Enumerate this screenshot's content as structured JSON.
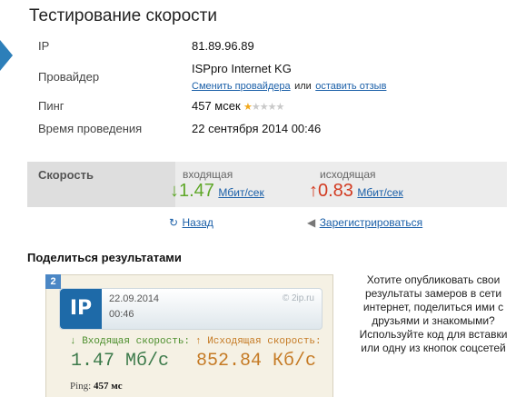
{
  "page": {
    "title": "Тестирование скорости"
  },
  "info": {
    "ip": {
      "label": "IP",
      "value": "81.89.96.89"
    },
    "provider": {
      "label": "Провайдер",
      "value": "ISPpro Internet KG",
      "change_link": "Сменить провайдера",
      "or": "или",
      "review_link": "оставить отзыв"
    },
    "ping": {
      "label": "Пинг",
      "value": "457 мсек",
      "rating": 1,
      "rating_max": 5
    },
    "time": {
      "label": "Время проведения",
      "value": "22 сентября 2014 00:46"
    }
  },
  "speed": {
    "header": "Скорость",
    "incoming": {
      "label": "входящая",
      "arrow": "↓",
      "value": "1.47",
      "unit": "Мбит/сек",
      "color": "#5ea728"
    },
    "outgoing": {
      "label": "исходящая",
      "arrow": "↑",
      "value": "0.83",
      "unit": "Мбит/сек",
      "color": "#d23a20"
    }
  },
  "actions": {
    "back": "Назад",
    "back_icon": "undo-arrow-icon",
    "register": "Зарегистрироваться",
    "register_icon": "megaphone-icon"
  },
  "share": {
    "title": "Поделиться результатами",
    "badge": "2",
    "card": {
      "logo": "IP",
      "date": "22.09.2014",
      "time": "00:46",
      "site": "© 2ip.ru",
      "in_label": "↓ Входящая скорость:",
      "in_value": "1.47 Мб/с",
      "out_label": "↑ Исходящая скорость:",
      "out_value": "852.84 Кб/с",
      "ping_label": "Ping:",
      "ping_value": "457 мс"
    },
    "description": "Хотите опубликовать свои результаты замеров в сети интернет, поделиться ими с друзьями и знакомыми? Используйте код для вставки или одну из кнопок соцсетей"
  }
}
